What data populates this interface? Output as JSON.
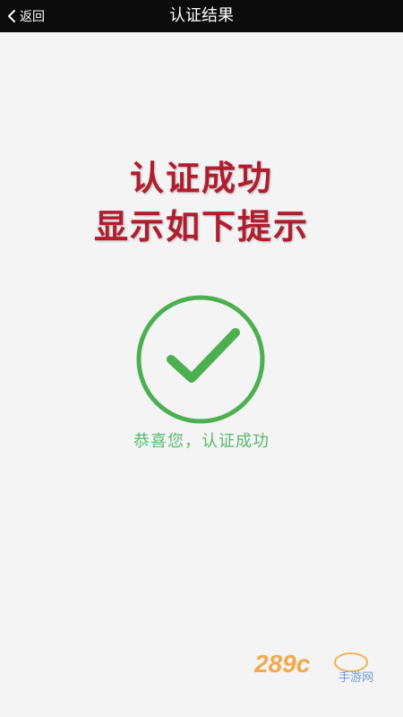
{
  "header": {
    "back_label": "返回",
    "title": "认证结果"
  },
  "notice": {
    "line1": "认证成功",
    "line2": "显示如下提示"
  },
  "result": {
    "message": "恭喜您，认证成功"
  },
  "watermark": {
    "logo_text": "289c",
    "sub_text": "手游网"
  },
  "colors": {
    "top_bar": "#0b0b0b",
    "background": "#f4f4f4",
    "headline": "#b01d2e",
    "success_green": "#4caf50"
  }
}
